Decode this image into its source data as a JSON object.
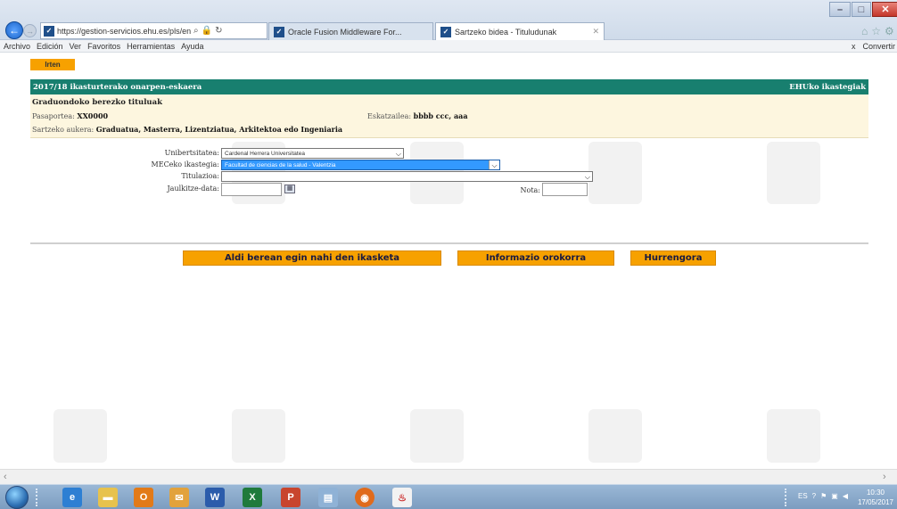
{
  "browser": {
    "url": "https://gestion-servicios.ehu.es/pls/entrada",
    "tabs": [
      {
        "label": "Oracle Fusion Middleware For..."
      },
      {
        "label": "Sartzeko bidea - Tituludunak"
      }
    ],
    "menu": [
      "Archivo",
      "Edición",
      "Ver",
      "Favoritos",
      "Herramientas",
      "Ayuda"
    ],
    "menu_right": {
      "close": "x",
      "convert": "Convertir"
    }
  },
  "page": {
    "exit_button": "Irten",
    "header_left": "2017/18 ikasturterako onarpen-eskaera",
    "header_right": "EHUko ikastegiak",
    "info": {
      "title": "Graduondoko berezko tituluak",
      "passport_label": "Pasaportea:",
      "passport_value": "XX0000",
      "applicant_label": "Eskatzailea:",
      "applicant_value": "bbbb ccc, aaa",
      "access_label": "Sartzeko aukera:",
      "access_value": "Graduatua, Masterra, Lizentziatua, Arkitektoa edo Ingeniaria"
    },
    "form": {
      "university_label": "Unibertsitatea:",
      "university_value": "Cardenal Herrera Universitatea",
      "mec_label": "MECeko ikastegia:",
      "mec_value": "Facultad de ciencias de la salud - Valentzia",
      "degree_label": "Titulazioa:",
      "degree_value": "",
      "date_label": "Jaulkitze-data:",
      "date_value": "",
      "grade_label": "Nota:",
      "grade_value": ""
    },
    "buttons": {
      "simultaneous": "Aldi berean egin nahi den ikasketa",
      "general_info": "Informazio orokorra",
      "next": "Hurrengora"
    }
  },
  "taskbar": {
    "lang": "ES",
    "time": "10:30",
    "date": "17/05/2017"
  }
}
